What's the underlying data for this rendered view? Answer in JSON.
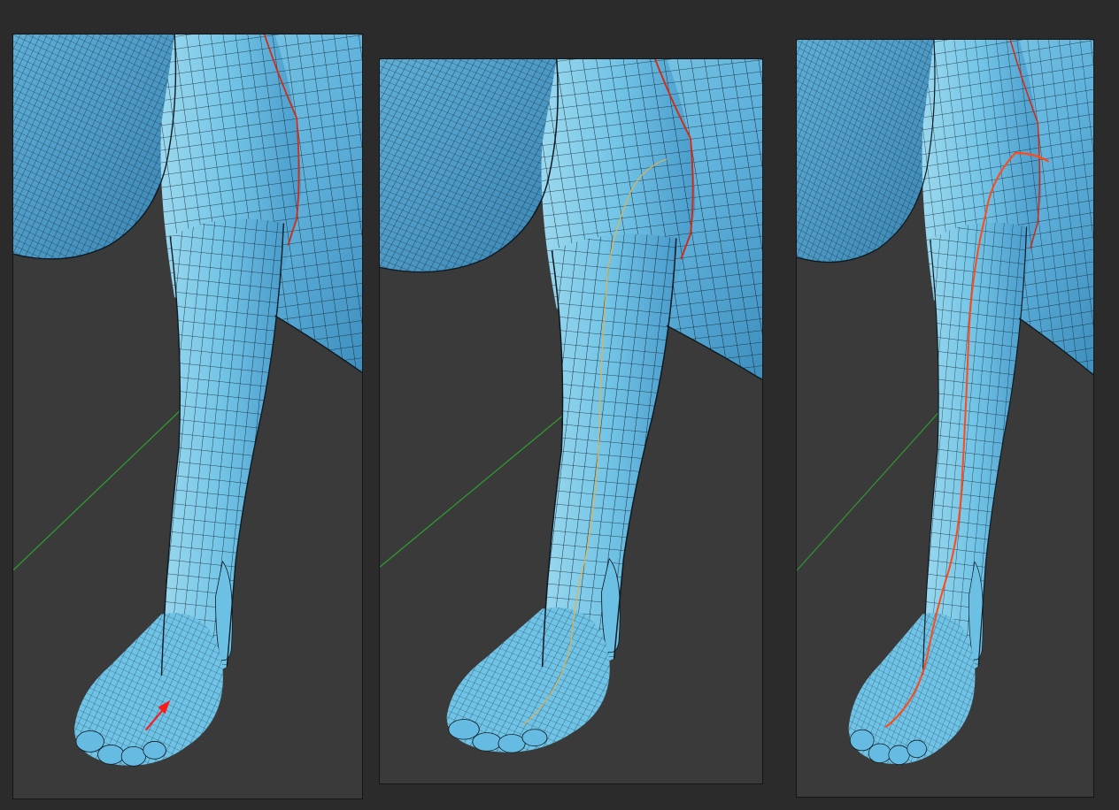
{
  "colors": {
    "app_background": "#2b2b2b",
    "viewport_background": "#3a3a3a",
    "mesh_light": "#7fcbe6",
    "mesh_mid": "#5fb3dc",
    "mesh_dark": "#3f8fbe",
    "wire": "#0d1a22",
    "grid_axis_green": "#2f9a2f",
    "edge_loop_selected": "#e0301a",
    "edge_loop_preview": "#e8b04a",
    "edge_loop_result": "#ff4a1a",
    "direction_arrow": "#ff1a1a"
  },
  "viewports": [
    {
      "name": "viewport-step-1",
      "show_arrow": true,
      "loop_style": "none"
    },
    {
      "name": "viewport-step-2",
      "show_arrow": false,
      "loop_style": "preview"
    },
    {
      "name": "viewport-step-3",
      "show_arrow": false,
      "loop_style": "result"
    }
  ]
}
